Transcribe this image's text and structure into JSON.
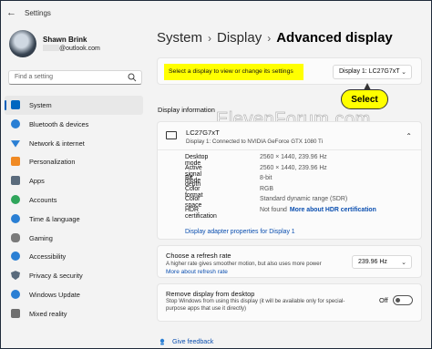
{
  "window": {
    "title": "Settings",
    "back_glyph": "←"
  },
  "user": {
    "name": "Shawn Brink",
    "email": "@outlook.com"
  },
  "search": {
    "placeholder": "Find a setting"
  },
  "nav": {
    "active": "System",
    "items": [
      {
        "label": "System",
        "icon": "system-icon",
        "color": "#0067c0"
      },
      {
        "label": "Bluetooth & devices",
        "icon": "bluetooth-icon",
        "color": "#2a7fd4"
      },
      {
        "label": "Network & internet",
        "icon": "network-icon",
        "color": "#2a7fd4"
      },
      {
        "label": "Personalization",
        "icon": "brush-icon",
        "color": "#f08a24"
      },
      {
        "label": "Apps",
        "icon": "apps-icon",
        "color": "#5a6b7c"
      },
      {
        "label": "Accounts",
        "icon": "accounts-icon",
        "color": "#2fa55b"
      },
      {
        "label": "Time & language",
        "icon": "time-language-icon",
        "color": "#2a7fd4"
      },
      {
        "label": "Gaming",
        "icon": "gaming-icon",
        "color": "#7a7a7a"
      },
      {
        "label": "Accessibility",
        "icon": "accessibility-icon",
        "color": "#2a7fd4"
      },
      {
        "label": "Privacy & security",
        "icon": "shield-icon",
        "color": "#5a6b7c"
      },
      {
        "label": "Windows Update",
        "icon": "windows-update-icon",
        "color": "#2a7fd4"
      },
      {
        "label": "Mixed reality",
        "icon": "mixed-reality-icon",
        "color": "#6f6f6f"
      }
    ]
  },
  "breadcrumb": {
    "part1": "System",
    "part2": "Display",
    "current": "Advanced display",
    "separator": "›"
  },
  "select_display": {
    "label": "Select a display to view or change its settings",
    "value": "Display 1: LC27G7xT",
    "chevron": "⌄",
    "highlight_color": "#ffff00"
  },
  "callout": {
    "text": "Select"
  },
  "watermark": "ElevenForum.com",
  "display_info": {
    "section_title": "Display information",
    "monitor_name": "LC27G7xT",
    "monitor_subtitle": "Display 1: Connected to NVIDIA GeForce GTX 1080 Ti",
    "collapse_chevron": "⌃",
    "rows": [
      {
        "key": "Desktop mode",
        "value": "2560 × 1440, 239.96 Hz",
        "link": ""
      },
      {
        "key": "Active signal mode",
        "value": "2560 × 1440, 239.96 Hz",
        "link": ""
      },
      {
        "key": "Bit depth",
        "value": "8-bit",
        "link": ""
      },
      {
        "key": "Color format",
        "value": "RGB",
        "link": ""
      },
      {
        "key": "Color space",
        "value": "Standard dynamic range (SDR)",
        "link": ""
      },
      {
        "key": "HDR certification",
        "value": "Not found",
        "link": "More about HDR certification"
      }
    ],
    "adapter_link": "Display adapter properties for Display 1"
  },
  "refresh": {
    "title": "Choose a refresh rate",
    "description": "A higher rate gives smoother motion, but also uses more power",
    "link": "More about refresh rate",
    "value": "239.96 Hz",
    "chevron": "⌄"
  },
  "remove_display": {
    "title": "Remove display from desktop",
    "description": "Stop Windows from using this display (it will be available only for special-purpose apps that use it directly)",
    "toggle_label": "Off",
    "toggle_on": false
  },
  "feedback": {
    "label": "Give feedback"
  },
  "colors": {
    "accent": "#005fb8",
    "link": "#0b4fb0",
    "highlight": "#ffff00"
  }
}
